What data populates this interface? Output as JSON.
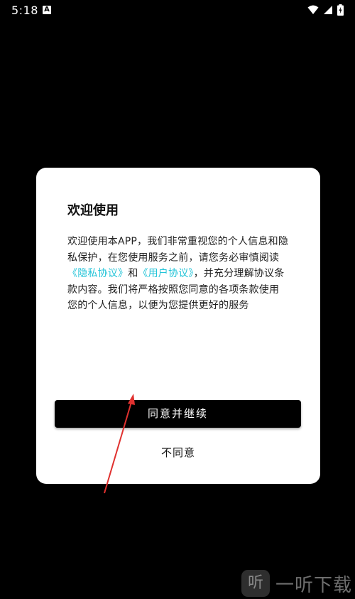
{
  "status_bar": {
    "time": "5:18",
    "notification_icon_letter": "A"
  },
  "dialog": {
    "title": "欢迎使用",
    "body": {
      "part1": "欢迎使用本APP，我们非常重视您的个人信息和隐私保护，在您使用服务之前，请您务必审慎阅读",
      "privacy_link": "《隐私协议》",
      "part2": "和",
      "user_agreement_link": "《用户协议》",
      "part3": "，并充分理解协议条款内容。我们将严格按照您同意的各项条款使用您的个人信息，以便为您提供更好的服务"
    },
    "agree_label": "同意并继续",
    "disagree_label": "不同意"
  },
  "watermark": {
    "logo_glyph": "听",
    "text": "一听下载"
  },
  "colors": {
    "background": "#000000",
    "dialog": "#ffffff",
    "link": "#24c4d8",
    "primary_button": "#000000",
    "annotation_arrow": "#e0312f"
  }
}
